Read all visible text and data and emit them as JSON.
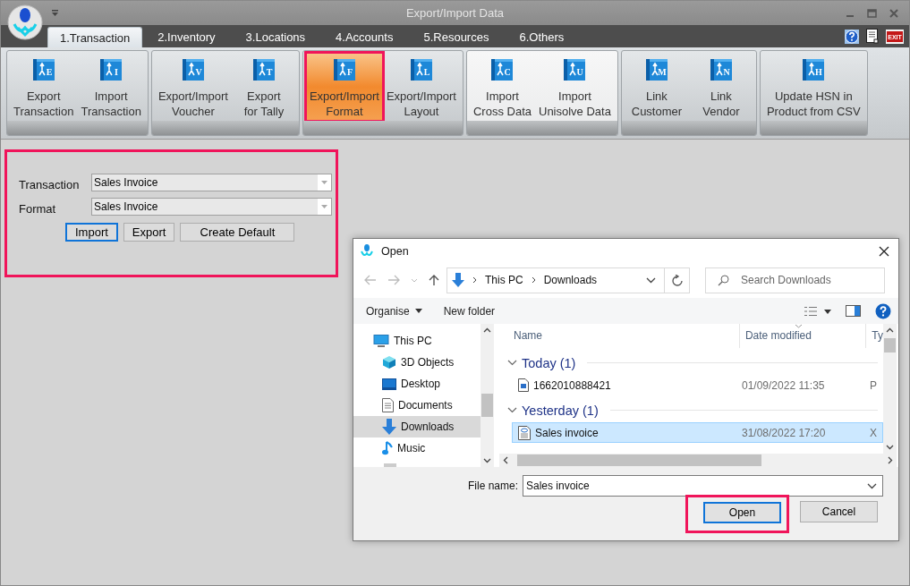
{
  "window": {
    "title": "Export/Import Data",
    "exit_label": "EXIT"
  },
  "tabs": [
    {
      "label": "1.Transaction",
      "selected": true
    },
    {
      "label": "2.Inventory",
      "selected": false
    },
    {
      "label": "3.Locations",
      "selected": false
    },
    {
      "label": "4.Accounts",
      "selected": false
    },
    {
      "label": "5.Resources",
      "selected": false
    },
    {
      "label": "6.Others",
      "selected": false
    }
  ],
  "ribbon": [
    {
      "hovered": false,
      "items": [
        {
          "label": "Export\nTransaction",
          "icon_letter": "E",
          "selected": false,
          "highlighted": false
        },
        {
          "label": "Import\nTransaction",
          "icon_letter": "I",
          "selected": false,
          "highlighted": false
        }
      ]
    },
    {
      "hovered": false,
      "items": [
        {
          "label": "Export/Import\nVoucher",
          "icon_letter": "V",
          "selected": false,
          "highlighted": false
        },
        {
          "label": "Export\nfor Tally",
          "icon_letter": "T",
          "selected": false,
          "highlighted": false
        }
      ]
    },
    {
      "hovered": false,
      "items": [
        {
          "label": "Export/Import\nFormat",
          "icon_letter": "F",
          "selected": true,
          "highlighted": true
        },
        {
          "label": "Export/Import\nLayout",
          "icon_letter": "L",
          "selected": false,
          "highlighted": false
        }
      ]
    },
    {
      "hovered": true,
      "items": [
        {
          "label": "Import\nCross Data",
          "icon_letter": "C",
          "selected": false,
          "highlighted": false
        },
        {
          "label": "Import\nUnisolve Data",
          "icon_letter": "U",
          "selected": false,
          "highlighted": false
        }
      ]
    },
    {
      "hovered": false,
      "items": [
        {
          "label": "Link\nCustomer",
          "icon_letter": "M",
          "selected": false,
          "highlighted": false
        },
        {
          "label": "Link\nVendor",
          "icon_letter": "N",
          "selected": false,
          "highlighted": false
        }
      ]
    },
    {
      "hovered": false,
      "items": [
        {
          "label": "Update HSN in\nProduct from CSV",
          "icon_letter": "H",
          "selected": false,
          "highlighted": false
        }
      ]
    }
  ],
  "form": {
    "highlighted": true,
    "fields": [
      {
        "label": "Transaction",
        "value": "Sales Invoice"
      },
      {
        "label": "Format",
        "value": "Sales Invoice"
      }
    ],
    "buttons": [
      {
        "label": "Import",
        "focused": true
      },
      {
        "label": "Export",
        "focused": false
      },
      {
        "label": "Create Default",
        "focused": false
      }
    ]
  },
  "dialog": {
    "title": "Open",
    "path": [
      "This PC",
      "Downloads"
    ],
    "search": {
      "placeholder": "Search Downloads"
    },
    "toolbar": {
      "organise": "Organise",
      "new_folder": "New folder"
    },
    "nav": [
      {
        "label": "This PC",
        "kind": "pc",
        "selected": false,
        "children": [
          {
            "label": "3D Objects",
            "kind": "cube",
            "selected": false
          },
          {
            "label": "Desktop",
            "kind": "desktop",
            "selected": false
          },
          {
            "label": "Documents",
            "kind": "documents",
            "selected": false
          },
          {
            "label": "Downloads",
            "kind": "downloads",
            "selected": true
          },
          {
            "label": "Music",
            "kind": "music",
            "selected": false
          }
        ]
      }
    ],
    "columns": [
      "Name",
      "Date modified",
      "Ty"
    ],
    "groups": [
      {
        "label": "Today (1)",
        "files": [
          {
            "name": "1662010888421",
            "kind": "image",
            "date": "01/09/2022 11:35",
            "type": "P",
            "selected": false
          }
        ]
      },
      {
        "label": "Yesterday (1)",
        "files": [
          {
            "name": "Sales invoice",
            "kind": "xml",
            "date": "31/08/2022 17:20",
            "type": "X",
            "selected": true
          }
        ]
      }
    ],
    "file_name": {
      "label": "File name:",
      "value": "Sales invoice"
    },
    "buttons": [
      {
        "label": "Open",
        "focused": true,
        "highlighted": true
      },
      {
        "label": "Cancel",
        "focused": false,
        "highlighted": false
      }
    ]
  }
}
